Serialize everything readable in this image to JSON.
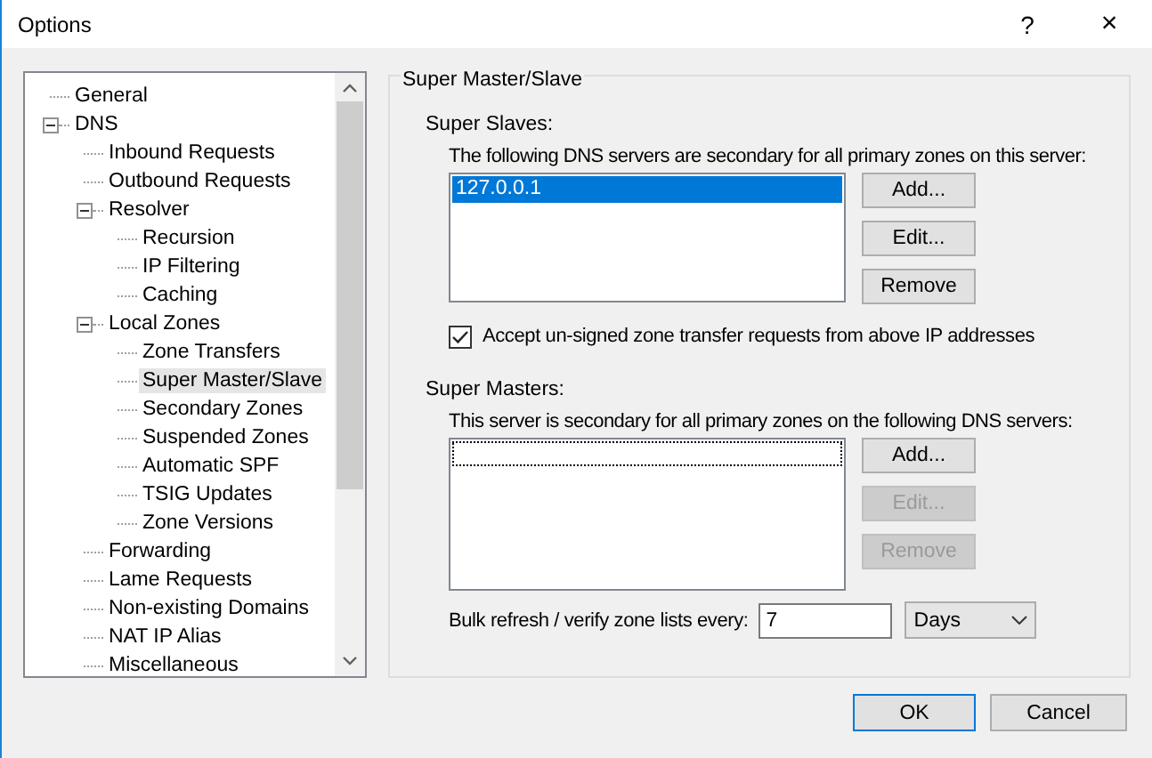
{
  "window": {
    "title": "Options",
    "help": "?",
    "close": "×"
  },
  "tree": {
    "items": [
      {
        "label": "General",
        "selected": false
      },
      {
        "label": "DNS",
        "selected": false,
        "expanded": true,
        "children": [
          {
            "label": "Inbound Requests",
            "selected": false
          },
          {
            "label": "Outbound Requests",
            "selected": false
          },
          {
            "label": "Resolver",
            "selected": false,
            "expanded": true,
            "children": [
              {
                "label": "Recursion",
                "selected": false
              },
              {
                "label": "IP Filtering",
                "selected": false
              },
              {
                "label": "Caching",
                "selected": false
              }
            ]
          },
          {
            "label": "Local Zones",
            "selected": false,
            "expanded": true,
            "children": [
              {
                "label": "Zone Transfers",
                "selected": false
              },
              {
                "label": "Super Master/Slave",
                "selected": true
              },
              {
                "label": "Secondary Zones",
                "selected": false
              },
              {
                "label": "Suspended Zones",
                "selected": false
              },
              {
                "label": "Automatic SPF",
                "selected": false
              },
              {
                "label": "TSIG Updates",
                "selected": false
              },
              {
                "label": "Zone Versions",
                "selected": false
              }
            ]
          },
          {
            "label": "Forwarding",
            "selected": false
          },
          {
            "label": "Lame Requests",
            "selected": false
          },
          {
            "label": "Non-existing Domains",
            "selected": false
          },
          {
            "label": "NAT IP Alias",
            "selected": false
          },
          {
            "label": "Miscellaneous",
            "selected": false
          }
        ]
      }
    ]
  },
  "group": {
    "title": "Super Master/Slave",
    "slaves": {
      "label": "Super Slaves:",
      "description": "The following DNS servers are secondary for all primary zones on this server:",
      "items": [
        {
          "label": "127.0.0.1",
          "selected": true
        }
      ],
      "buttons": [
        {
          "label": "Add...",
          "disabled": false
        },
        {
          "label": "Edit...",
          "disabled": false
        },
        {
          "label": "Remove",
          "disabled": false
        }
      ],
      "checkbox": {
        "label": "Accept un-signed zone transfer requests from above IP addresses",
        "checked": true
      }
    },
    "masters": {
      "label": "Super Masters:",
      "description": "This server is secondary for all primary zones on the following DNS servers:",
      "buttons": [
        {
          "label": "Add...",
          "disabled": false
        },
        {
          "label": "Edit...",
          "disabled": true
        },
        {
          "label": "Remove",
          "disabled": true
        }
      ]
    },
    "refresh": {
      "label": "Bulk refresh / verify zone lists every:",
      "value": "7",
      "unit": "Days"
    }
  },
  "buttons": [
    "OK",
    "Cancel"
  ]
}
